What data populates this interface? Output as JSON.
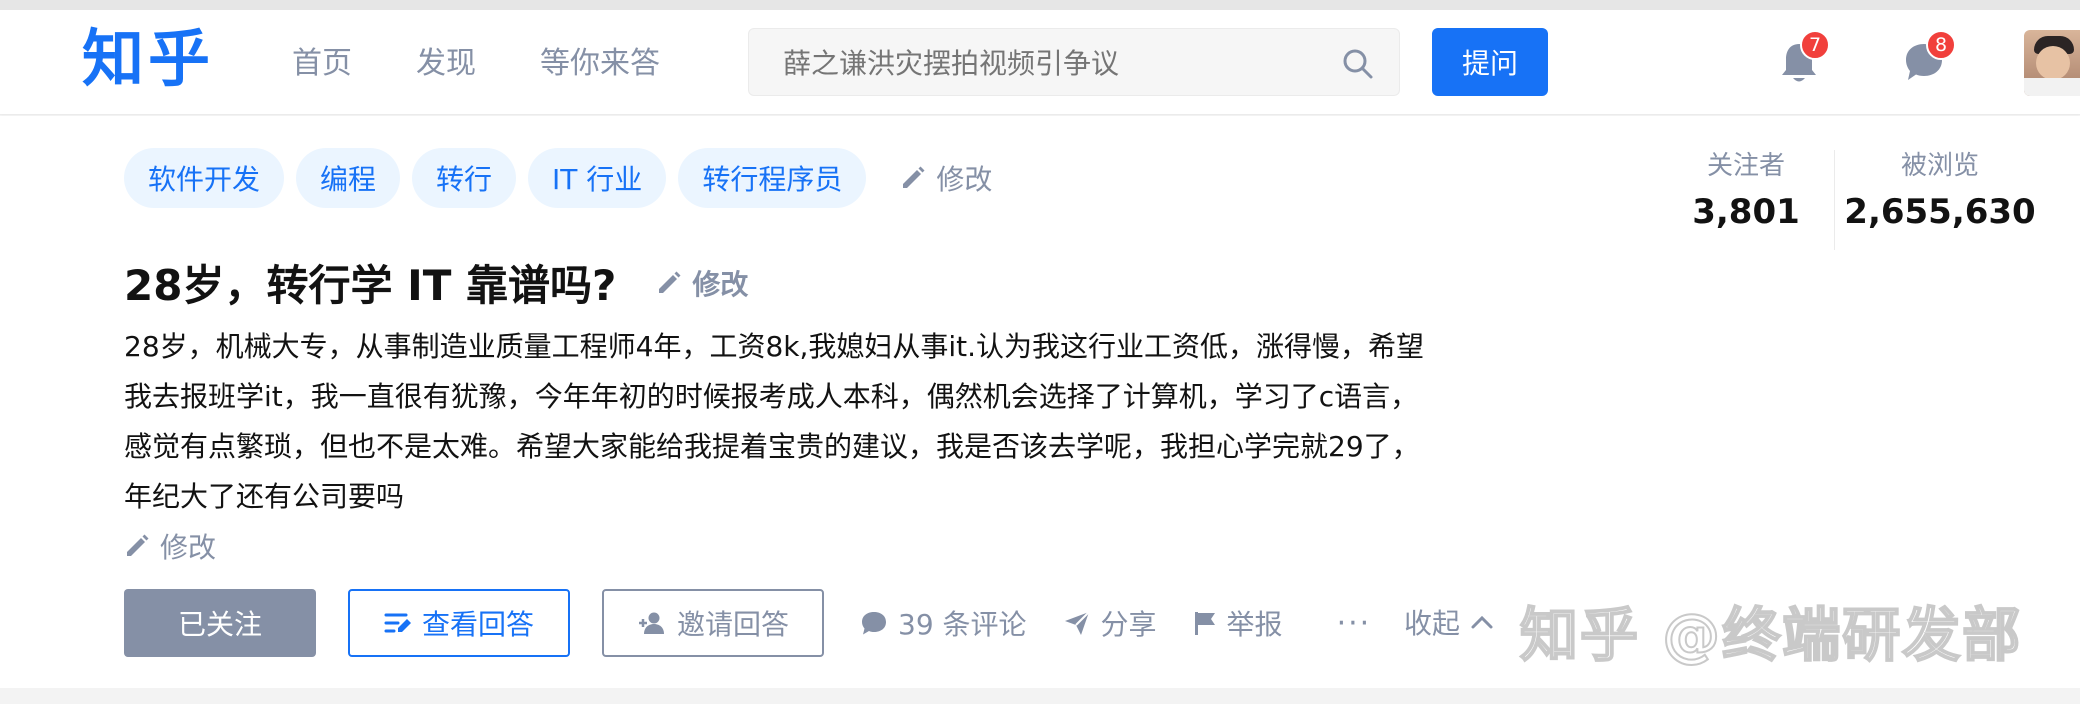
{
  "header": {
    "logo": "知乎",
    "nav": [
      "首页",
      "发现",
      "等你来答"
    ],
    "search_placeholder": "薛之谦洪灾摆拍视频引争议",
    "ask_label": "提问",
    "notification_count": "7",
    "message_count": "8"
  },
  "question": {
    "tags": [
      "软件开发",
      "编程",
      "转行",
      "IT 行业",
      "转行程序员"
    ],
    "edit_label": "修改",
    "title": "28岁，转行学 IT 靠谱吗?",
    "detail": "28岁，机械大专，从事制造业质量工程师4年，工资8k,我媳妇从事it.认为我这行业工资低，涨得慢，希望我去报班学it，我一直很有犹豫，今年年初的时候报考成人本科，偶然机会选择了计算机，学习了c语言，感觉有点繁琐，但也不是太难。希望大家能给我提着宝贵的建议，我是否该去学呢，我担心学完就29了，年纪大了还有公司要吗",
    "followers_label": "关注者",
    "followers_value": "3,801",
    "views_label": "被浏览",
    "views_value": "2,655,630"
  },
  "actions": {
    "followed": "已关注",
    "view_answers": "查看回答",
    "invite": "邀请回答",
    "comments": "39 条评论",
    "share": "分享",
    "report": "举报",
    "more": "···",
    "collapse": "收起"
  },
  "watermark": "知乎 @终端研发部",
  "colors": {
    "brand": "#1772f6",
    "gray": "#8590a6",
    "badge": "#f1403c"
  },
  "icons": [
    "search-icon",
    "bell-icon",
    "message-icon",
    "pencil-icon",
    "answers-icon",
    "invite-icon",
    "comment-icon",
    "share-icon",
    "flag-icon",
    "chevron-up-icon"
  ]
}
